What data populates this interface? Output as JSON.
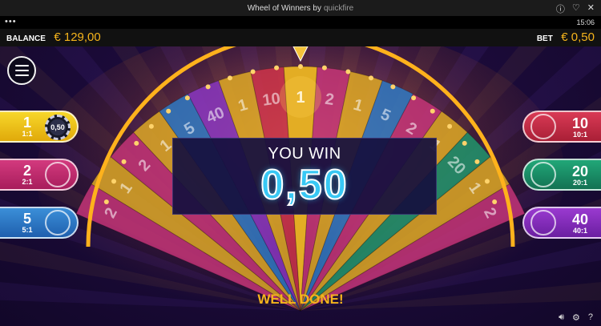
{
  "window": {
    "title": "Wheel of Winners by",
    "brand": "quickfire"
  },
  "status": {
    "dots": "•••",
    "clock": "15:06"
  },
  "balance": {
    "label": "BALANCE",
    "value": "€ 129,00"
  },
  "bet": {
    "label": "BET",
    "value": "€ 0,50"
  },
  "wheel": {
    "segments": [
      "2",
      "1",
      "2",
      "1",
      "5",
      "40",
      "1",
      "10",
      "1",
      "2",
      "1",
      "5",
      "2",
      "1",
      "20",
      "1",
      "2"
    ],
    "selected": "1"
  },
  "left_tabs": [
    {
      "number": "1",
      "ratio": "1:1",
      "chip": "0,50"
    },
    {
      "number": "2",
      "ratio": "2:1"
    },
    {
      "number": "5",
      "ratio": "5:1"
    }
  ],
  "right_tabs": [
    {
      "number": "10",
      "ratio": "10:1"
    },
    {
      "number": "20",
      "ratio": "20:1"
    },
    {
      "number": "40",
      "ratio": "40:1"
    }
  ],
  "win": {
    "title": "YOU WIN",
    "amount": "0,50"
  },
  "message": "WELL DONE!",
  "colors": {
    "accent": "#f5b41c",
    "win_blue": "#38c8f4"
  }
}
